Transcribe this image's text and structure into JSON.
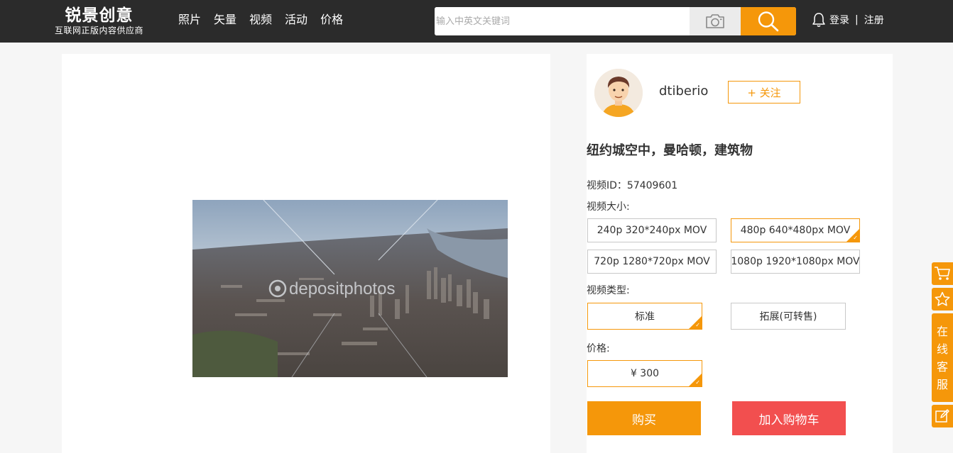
{
  "header": {
    "logo_main": "锐景创意",
    "logo_sub": "互联网正版内容供应商",
    "nav": [
      "照片",
      "矢量",
      "视频",
      "活动",
      "价格"
    ],
    "search_placeholder": "输入中英文关键词",
    "login": "登录",
    "separator": "|",
    "register": "注册",
    "icons": {
      "camera": "camera-icon",
      "search": "search-icon",
      "bell": "bell-icon"
    }
  },
  "preview": {
    "watermark": "depositphotos"
  },
  "author": {
    "name": "dtiberio",
    "follow_label": "+ 关注"
  },
  "video": {
    "title": "纽约城空中，曼哈顿，建筑物",
    "id_label": "视频ID：57409601",
    "size_label": "视频大小:",
    "sizes": [
      "240p 320*240px MOV",
      "480p 640*480px MOV",
      "720p 1280*720px MOV",
      "1080p 1920*1080px MOV"
    ],
    "selected_size": 1,
    "type_label": "视频类型:",
    "types": [
      "标准",
      "拓展(可转售)"
    ],
    "selected_type": 0,
    "price_label": "价格:",
    "price": "¥ 300",
    "buy_label": "购买",
    "cart_label": "加入购物车"
  },
  "sidebar": {
    "cart_icon": "cart-icon",
    "star_icon": "star-icon",
    "service_chars": [
      "在",
      "线",
      "客",
      "服"
    ],
    "edit_icon": "edit-icon"
  },
  "colors": {
    "accent": "#f5970a",
    "cart_red": "#f24f4f",
    "header_bg": "#2b2b2b"
  }
}
